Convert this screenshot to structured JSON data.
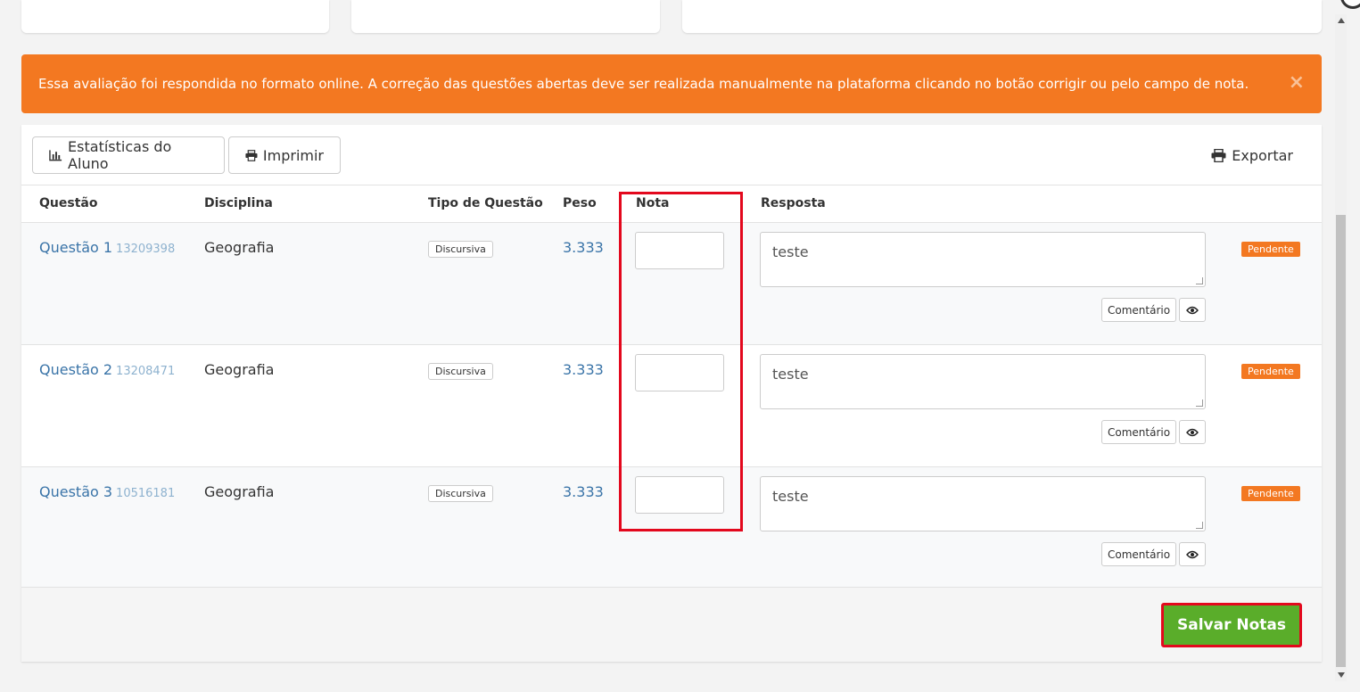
{
  "alert": {
    "message": "Essa avaliação foi respondida no formato online. A correção das questões abertas deve ser realizada manualmente na plataforma clicando no botão corrigir ou pelo campo de nota.",
    "close_symbol": "×"
  },
  "toolbar": {
    "stats_label": "Estatísticas do Aluno",
    "print_label": "Imprimir",
    "export_label": "Exportar"
  },
  "table": {
    "headers": {
      "questao": "Questão",
      "disciplina": "Disciplina",
      "tipo": "Tipo de Questão",
      "peso": "Peso",
      "nota": "Nota",
      "resposta": "Resposta"
    },
    "rows": [
      {
        "questao": "Questão 1",
        "id": "13209398",
        "disciplina": "Geografia",
        "tipo": "Discursiva",
        "peso": "3.333",
        "nota": "",
        "resposta": "teste",
        "comentario": "Comentário",
        "status": "Pendente"
      },
      {
        "questao": "Questão 2",
        "id": "13208471",
        "disciplina": "Geografia",
        "tipo": "Discursiva",
        "peso": "3.333",
        "nota": "",
        "resposta": "teste",
        "comentario": "Comentário",
        "status": "Pendente"
      },
      {
        "questao": "Questão 3",
        "id": "10516181",
        "disciplina": "Geografia",
        "tipo": "Discursiva",
        "peso": "3.333",
        "nota": "",
        "resposta": "teste",
        "comentario": "Comentário",
        "status": "Pendente"
      }
    ]
  },
  "footer": {
    "save_label": "Salvar Notas"
  },
  "colors": {
    "alert": "#f37821",
    "link": "#3a74a8",
    "save": "#5aad2a",
    "highlight": "#e3081d"
  },
  "icons": {
    "stats": "bar-chart-icon",
    "print": "printer-icon",
    "export": "printer-icon",
    "view": "eye-icon",
    "close": "close-icon"
  }
}
